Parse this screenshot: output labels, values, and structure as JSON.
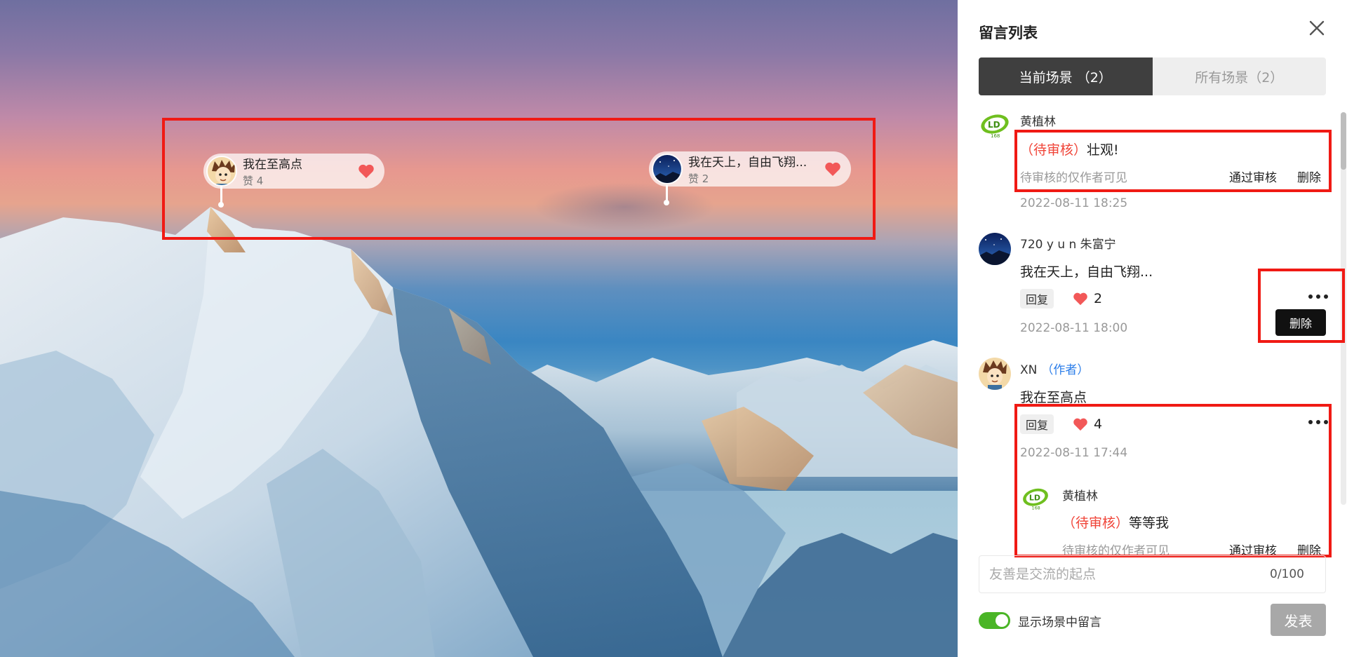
{
  "scene": {
    "markers": [
      {
        "title": "我在至高点",
        "likes": "赞 4",
        "avatar": "cartoon-boy-avatar"
      },
      {
        "title": "我在天上，自由飞翔...",
        "likes": "赞 2",
        "avatar": "night-sky-avatar"
      }
    ]
  },
  "panel": {
    "title": "留言列表",
    "tabs": [
      {
        "label": "当前场景 （2）",
        "active": true
      },
      {
        "label": "所有场景（2）",
        "active": false
      }
    ],
    "comments": [
      {
        "user": "黄植林",
        "avatar": "ld-logo-avatar",
        "status": "（待审核）",
        "text": "壮观!",
        "note": "待审核的仅作者可见",
        "approve": "通过审核",
        "delete": "删除",
        "time": "2022-08-11 18:25"
      },
      {
        "user": "720 y u n 朱富宁",
        "avatar": "night-sky-avatar",
        "text": "我在天上，自由飞翔...",
        "reply": "回复",
        "likes": "2",
        "delete": "删除",
        "time": "2022-08-11 18:00"
      },
      {
        "user": "XN",
        "author_tag": "（作者）",
        "avatar": "cartoon-boy-avatar",
        "text": "我在至高点",
        "reply": "回复",
        "likes": "4",
        "time": "2022-08-11 17:44",
        "replies": [
          {
            "user": "黄植林",
            "avatar": "ld-logo-avatar",
            "status": "（待审核）",
            "text": "等等我",
            "note": "待审核的仅作者可见",
            "approve": "通过审核",
            "delete": "删除"
          }
        ]
      }
    ],
    "input": {
      "placeholder": "友善是交流的起点",
      "counter": "0/100"
    },
    "toggle": {
      "label": "显示场景中留言",
      "on": true
    },
    "post_label": "发表"
  },
  "colors": {
    "highlight": "#f01a14",
    "pending": "#f04438",
    "author": "#2b7de9",
    "heart": "#f25858",
    "toggle_on": "#4ab526",
    "tab_active": "#3f3f3f"
  }
}
